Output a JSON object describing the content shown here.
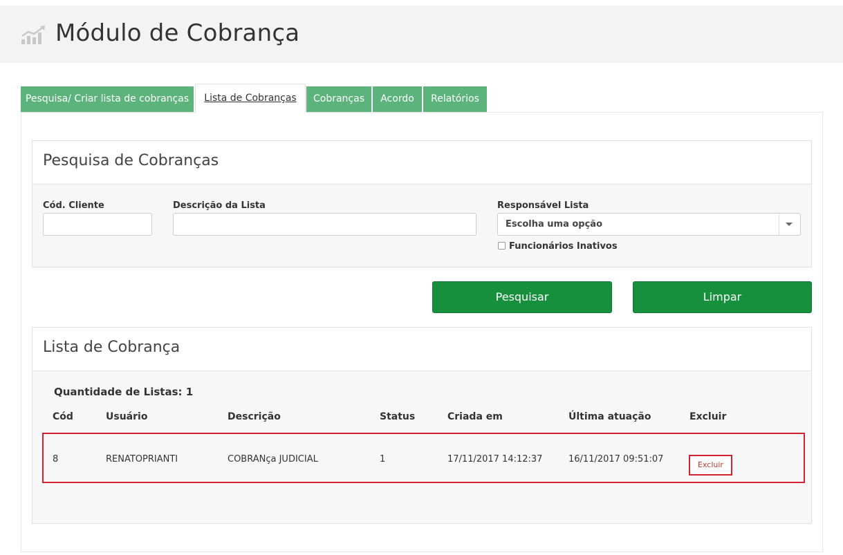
{
  "header": {
    "title": "Módulo de Cobrança",
    "icon": "bar-chart-icon"
  },
  "tabs": [
    {
      "label": "Pesquisa/ Criar lista de cobranças",
      "active": false
    },
    {
      "label": "Lista de Cobranças",
      "active": true
    },
    {
      "label": "Cobranças",
      "active": false
    },
    {
      "label": "Acordo",
      "active": false
    },
    {
      "label": "Relatórios",
      "active": false
    }
  ],
  "search_panel": {
    "title": "Pesquisa de Cobranças",
    "cod_cliente": {
      "label": "Cód. Cliente",
      "value": ""
    },
    "descricao": {
      "label": "Descrição da Lista",
      "value": ""
    },
    "responsavel": {
      "label": "Responsável Lista",
      "selected": "Escolha uma opção"
    },
    "inativos": {
      "label": "Funcionários Inativos",
      "checked": false
    }
  },
  "buttons": {
    "search": "Pesquisar",
    "clear": "Limpar"
  },
  "list_panel": {
    "title": "Lista de Cobrança",
    "quantity": "Quantidade de Listas: 1",
    "columns": [
      "Cód",
      "Usuário",
      "Descrição",
      "Status",
      "Criada em",
      "Última atuação",
      "Excluir"
    ],
    "rows": [
      {
        "cod": "8",
        "usuario": "RENATOPRIANTI",
        "descricao": "COBRANça JUDICIAL",
        "status": "1",
        "criada_em": "17/11/2017 14:12:37",
        "ultima_atuacao": "16/11/2017 09:51:07",
        "excluir": "Excluir"
      }
    ]
  },
  "colors": {
    "tab_green": "#5cb47c",
    "button_green": "#17903e",
    "highlight_red": "#d42030"
  }
}
